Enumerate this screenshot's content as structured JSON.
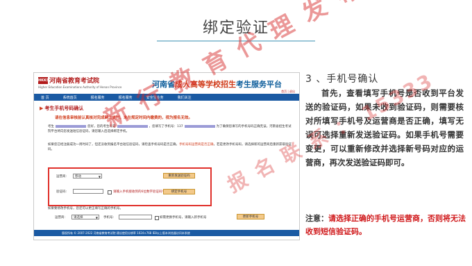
{
  "slide": {
    "title": "绑定验证",
    "section_heading": "3 、手机号确认",
    "body": "首先，查看填写手机号是否收到平台发送的验证码，如果未收到验证码，则需要核对所填写手机号及运营商是否正确，填写无误可选择重新发送验证码。如果手机号需要变更，可以重新修改并选择新号码对应的运营商，再次发送验证码即可。",
    "note_label": "注意：",
    "note_text": "请选择正确的手机号运营商，否则将无法收到短信验证码。",
    "watermark_line1": "新 行 教 育 代 理 发 布",
    "watermark_line2": "报 名 联 系 ： 15333",
    "accent_color": "#d0191b"
  },
  "screenshot": {
    "logo_text": "HKKS",
    "exam_name": "河南省教育考试院",
    "exam_sub": "Higher Education Examinations Authority of Henan Province",
    "platform_title_pre": "河南省",
    "platform_title_hl": "成人高等学校招生",
    "platform_title_post": "考生服务平台",
    "head_links": "首页  |  退出",
    "nav": [
      "首 页",
      "系统首页",
      "报名服务",
      "报名服务",
      "安全生业务",
      "我们关注"
    ],
    "card_title": "考生手机号码确认",
    "warning": "请在信息审核前认真核对完成网上支付，未在规定时间内缴费的，视为报名无效。",
    "para1_a": "考生",
    "para1_b": "您好，您的考生号是",
    "para1_c": "，您填写了手机号：137",
    "para1_d": "为了确保您填写的手机号码正确无误，河南省招生考试院平台将向您发送短信验证码，请您输入后选择绑定手机。",
    "para2_a": "如果您已经注册成功一周时间了，但还没收到报名平台短信验证码，请检查手机号码是否正确，",
    "para2_red": "手机号码运营商是否正确",
    "para2_b": "，若是更改手机号码，请选择新的运营商后重新获取验证码。",
    "carrier_label": "运营商:",
    "carrier_value": "移动",
    "resend_button": "重新发送验证码",
    "code_label": "验证码:",
    "code_hint": "请输入手机接收到的6位数字验证码!",
    "bind_button": "绑定手机号",
    "change_text": "如果要修改手机号，您还可以更正填写正确的手机号。",
    "change_carrier_label": "运营商:",
    "change_carrier_value": "请选择",
    "phone_label": "手机号:",
    "change_hint": "如需更换手机号，请输入新手机号",
    "change_button": "更新手机号",
    "footer": "版权所有 © 2007-2022 河南省教育考试院   建议使用分辨率 1024×768 IE8以上版本浏览器访问本系统"
  }
}
